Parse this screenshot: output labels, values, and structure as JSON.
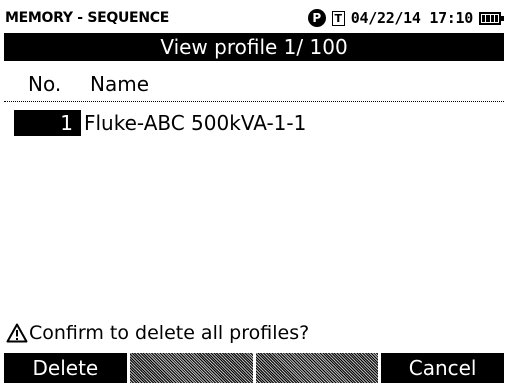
{
  "status": {
    "mode_title": "MEMORY - SEQUENCE",
    "p_icon": "P",
    "t_icon": "T",
    "datetime": "04/22/14 17:10",
    "battery_level": 1.0
  },
  "header": {
    "title": "View profile 1/ 100"
  },
  "table": {
    "columns": [
      "No.",
      "Name"
    ],
    "rows": [
      {
        "no": "1",
        "name": "Fluke-ABC 500kVA-1-1"
      }
    ]
  },
  "warning": {
    "text": "Confirm to delete all profiles?"
  },
  "softkeys": [
    "Delete",
    "",
    "",
    "Cancel"
  ],
  "icons": [
    "p-icon",
    "t-icon",
    "battery-icon",
    "warning-icon"
  ]
}
